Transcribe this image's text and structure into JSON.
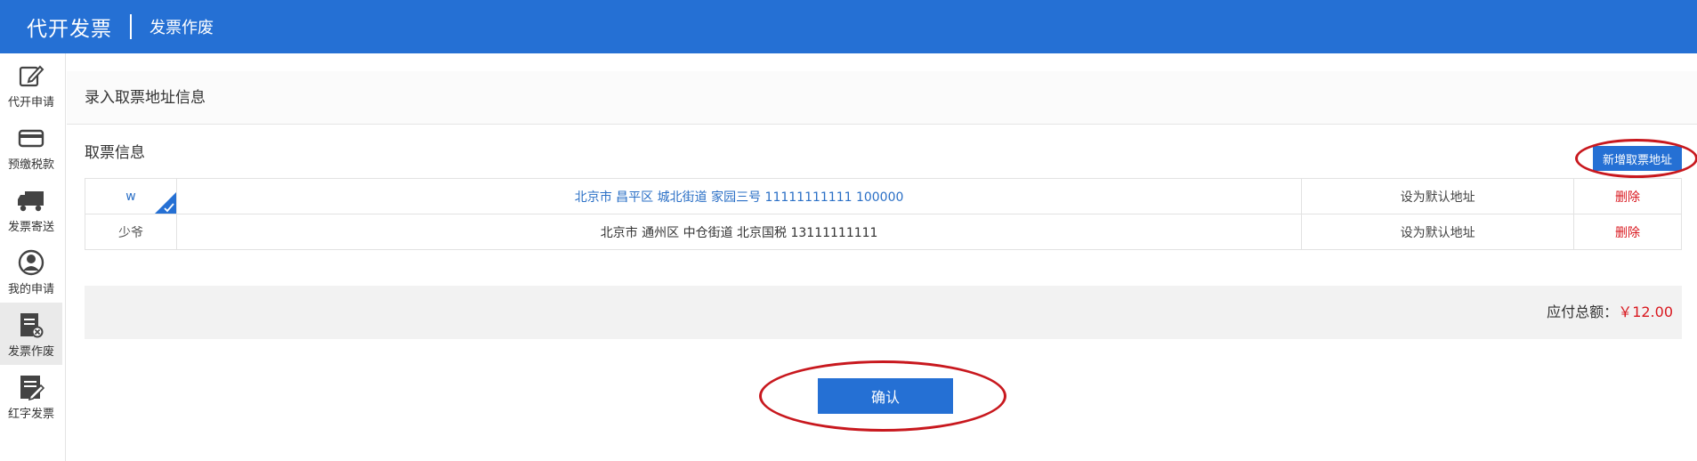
{
  "header": {
    "title": "代开发票",
    "subtitle": "发票作废"
  },
  "sidebar": {
    "items": [
      {
        "label": "代开申请",
        "icon": "edit-icon"
      },
      {
        "label": "预缴税款",
        "icon": "card-icon"
      },
      {
        "label": "发票寄送",
        "icon": "truck-icon"
      },
      {
        "label": "我的申请",
        "icon": "user-icon"
      },
      {
        "label": "发票作废",
        "icon": "invoice-cancel-icon"
      },
      {
        "label": "红字发票",
        "icon": "invoice-edit-icon"
      }
    ]
  },
  "main": {
    "section_title": "录入取票地址信息",
    "pick_title": "取票信息",
    "add_button": "新增取票地址",
    "addresses": [
      {
        "name": "w",
        "address": "北京市 昌平区 城北街道 家园三号 11111111111 100000",
        "set_default": "设为默认地址",
        "delete": "删除"
      },
      {
        "name": "少爷",
        "address": "北京市 通州区 中仓街道 北京国税 13111111111",
        "set_default": "设为默认地址",
        "delete": "删除"
      }
    ],
    "total_label": "应付总额：",
    "total_amount": "￥12.00",
    "confirm_button": "确认"
  },
  "colors": {
    "brand": "#2570d4",
    "danger": "#d9181f",
    "annotation": "#c8181e"
  }
}
